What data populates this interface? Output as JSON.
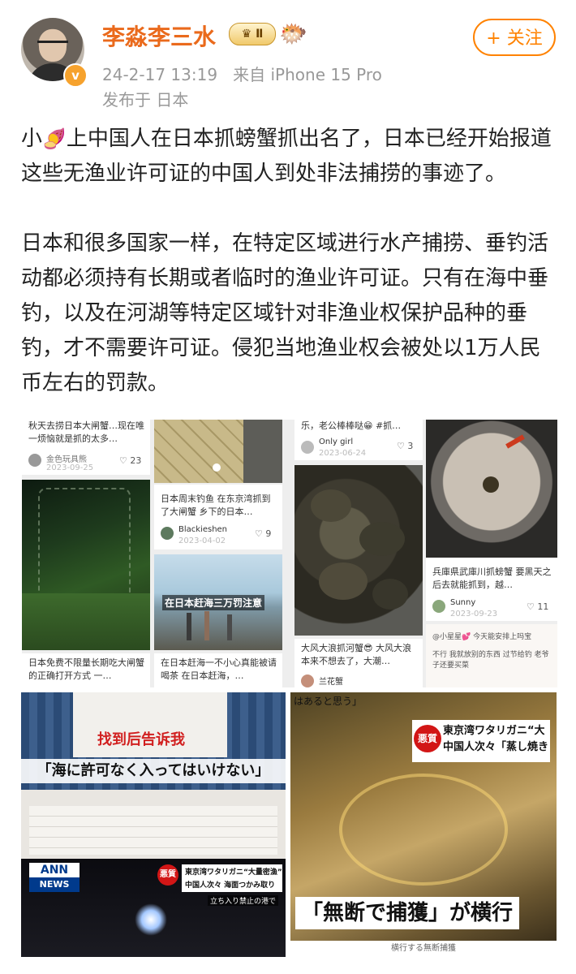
{
  "user": {
    "name": "李淼李三水",
    "badge": "Ⅱ",
    "follow_label": "+ 关注",
    "timestamp": "24-2-17 13:19",
    "source": "来自 iPhone 15 Pro",
    "location": "发布于 日本"
  },
  "post": {
    "para1_prefix": "小",
    "para1_emoji": "🍠",
    "para1_text": "上中国人在日本抓螃蟹抓出名了，日本已经开始报道这些无渔业许可证的中国人到处非法捕捞的事迹了。",
    "para2_text": "日本和很多国家一样，在特定区域进行水产捕捞、垂钓活动都必须持有长期或者临时的渔业许可证。只有在海中垂钓，以及在河湖等特定区域针对非渔业权保护品种的垂钓，才不需要许可证。侵犯当地渔业权会被处以1万人民币左右的罚款。"
  },
  "cards": [
    {
      "caption": "秋天去捞日本大闸蟹…现在唯一烦恼就是抓的太多…",
      "author": "金色玩具熊",
      "date": "2023-09-25",
      "likes": "23"
    },
    {
      "caption": "日本周末钓鱼 在东京湾抓到了大闸蟹 乡下的日本…",
      "author": "Blackieshen",
      "date": "2023-04-02",
      "likes": "9"
    },
    {
      "caption": "日本免费不限量长期吃大闸蟹的正确打开方式 一…",
      "author": "",
      "date": "",
      "likes": ""
    },
    {
      "caption": "在日本赶海一不小心真能被请喝茶 在日本赶海，…",
      "author": "",
      "date": "",
      "likes": ""
    },
    {
      "caption": "乐，老公棒棒哒😁 #抓…",
      "author": "Only girl",
      "date": "2023-06-24",
      "likes": "3"
    },
    {
      "caption": "大风大浪抓河蟹😎 大风大浪本来不想去了，大潮…",
      "author": "兰花蟹",
      "date": "",
      "likes": ""
    },
    {
      "caption": "兵庫県武庫川抓螃蟹 要黑天之后去就能抓到，越…",
      "author": "Sunny",
      "date": "2023-09-23",
      "likes": "11"
    }
  ],
  "overlays": {
    "photo_caption": "在日本赶海三万罚注意",
    "red_sign": "找到后告诉我",
    "jp_banner": "「海に許可なく入ってはいけない」",
    "comment1": "@小星星💕 今天能安排上吗宝",
    "comment2": "不行 我就放别的东西 过节给钓 老爷子还要买菜",
    "ann": "ANN",
    "news": "NEWS",
    "tv_tag": "悪質",
    "tv_line1": "東京湾ワタリガニ“大量密漁”",
    "tv_line2": "中国人次々 海面つかみ取り",
    "tv_line3": "立ち入り禁止の港で",
    "right_tag": "悪質",
    "right_line1": "東京湾ワタリガニ“大",
    "right_line2": "中国人次々「蒸し焼き",
    "right_top": "はあると思う」",
    "right_banner": "「無断で捕獲」が横行",
    "right_sub": "横行する無断捕獲"
  }
}
